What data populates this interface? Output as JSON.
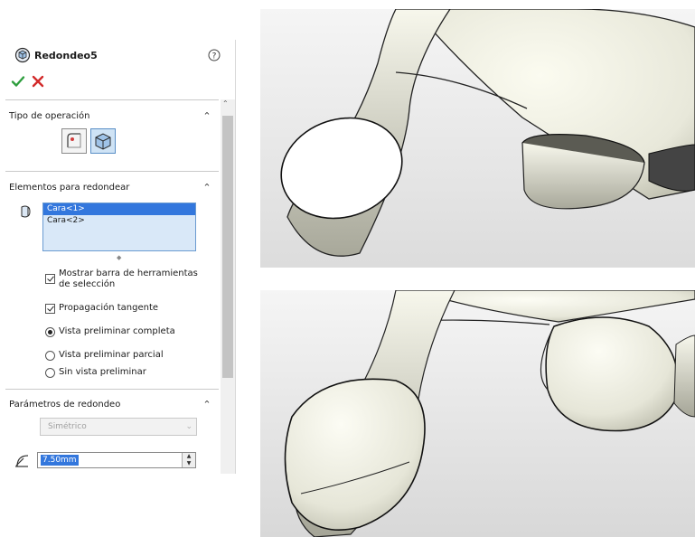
{
  "feature": {
    "title": "Redondeo5",
    "help_icon": "help-icon",
    "ok_icon": "checkmark-icon",
    "cancel_icon": "x-icon",
    "ok_color": "#2e9e3e",
    "cancel_color": "#d22a2a"
  },
  "sections": {
    "operation_type": {
      "title": "Tipo de operación"
    },
    "items_to_fillet": {
      "title": "Elementos para redondear",
      "list": [
        "Cara<1>",
        "Cara<2>"
      ],
      "options": [
        {
          "label": "Mostrar barra de herramientas de selección",
          "checked": true
        },
        {
          "label": "Propagación tangente",
          "checked": true
        }
      ],
      "preview_options": [
        {
          "label": "Vista preliminar completa",
          "selected": true
        },
        {
          "label": "Vista preliminar parcial",
          "selected": false
        },
        {
          "label": "Sin vista preliminar",
          "selected": false
        }
      ]
    },
    "fillet_parameters": {
      "title": "Parámetros de redondeo",
      "type_value": "Simétrico",
      "radius_value": "7.50mm"
    }
  },
  "colors": {
    "selection_blue": "#3377dd",
    "model_face": "#f4f4e8",
    "viewport_bg": "#e6e6e6"
  }
}
